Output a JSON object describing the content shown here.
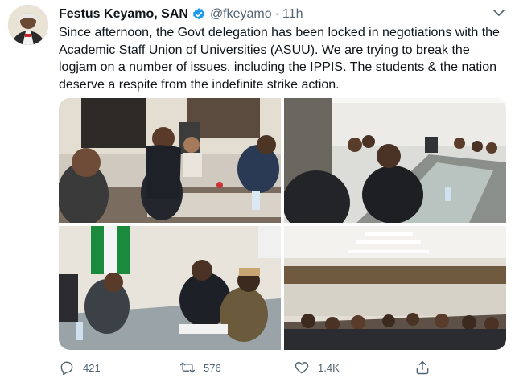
{
  "author": {
    "name": "Festus Keyamo, SAN",
    "handle": "@fkeyamo",
    "separator": "·",
    "time": "11h",
    "avatar_icon": "avatar-portrait"
  },
  "tweet": {
    "text": "Since afternoon, the Govt delegation has been locked in negotiations with the Academic Staff Union of Universities (ASUU). We are trying to break the logjam on a number of issues, including the IPPIS. The students & the nation deserve a respite from the indefinite strike action."
  },
  "media": {
    "count": 4
  },
  "actions": {
    "replies": "421",
    "retweets": "576",
    "likes": "1.4K"
  },
  "colors": {
    "verified": "#1d9bf0",
    "text": "#0f1419",
    "secondary": "#536471"
  }
}
